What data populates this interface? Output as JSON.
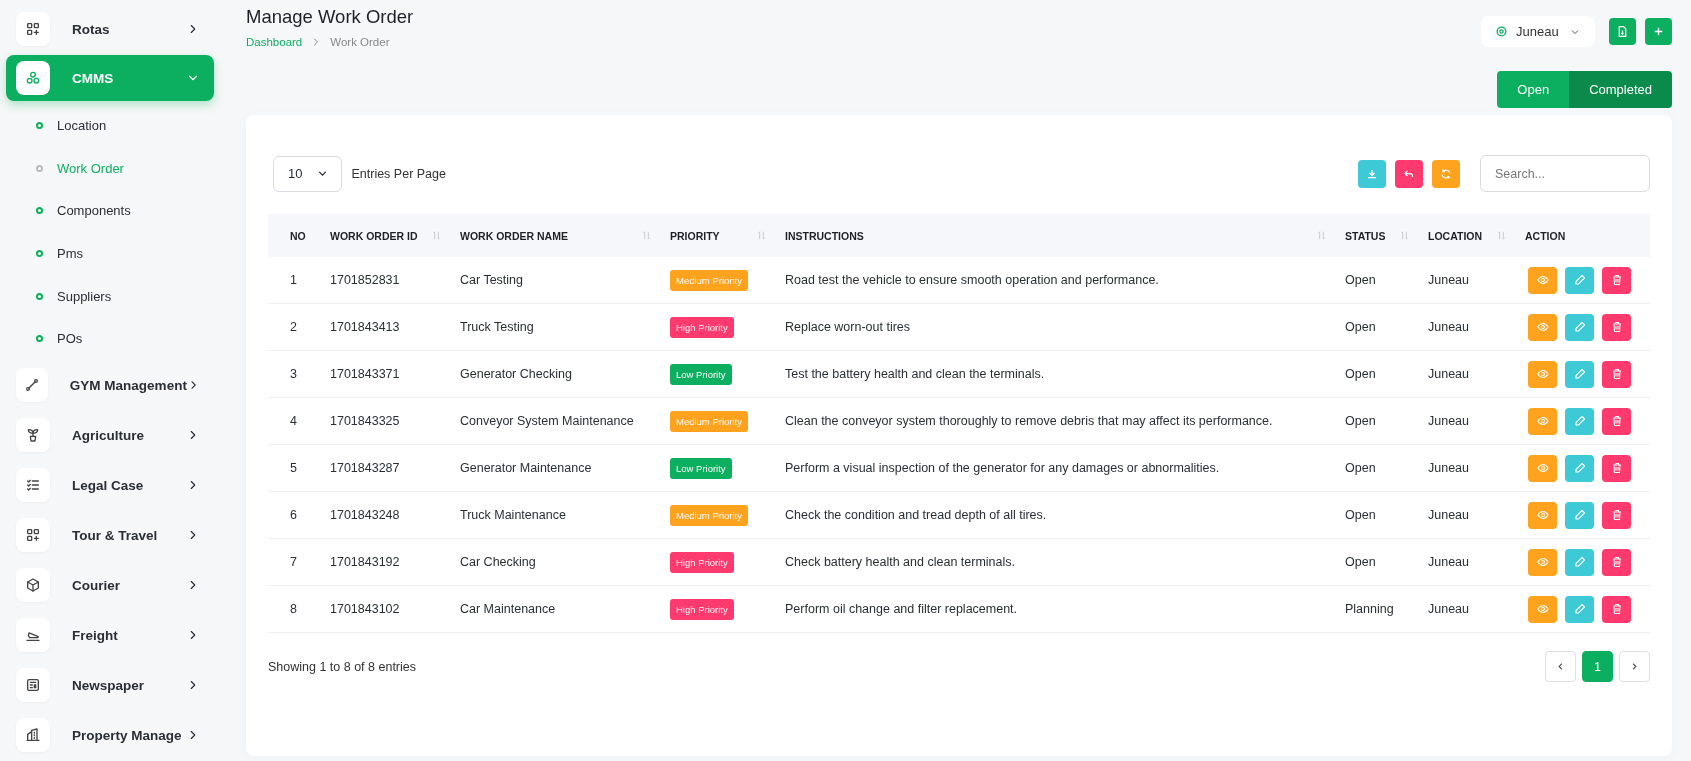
{
  "sidebar": {
    "items": [
      {
        "label": "Rotas",
        "selected": false,
        "expanded": false
      },
      {
        "label": "CMMS",
        "selected": true,
        "expanded": true,
        "children": [
          {
            "label": "Location",
            "selected": false
          },
          {
            "label": "Work Order",
            "selected": true
          },
          {
            "label": "Components",
            "selected": false
          },
          {
            "label": "Pms",
            "selected": false
          },
          {
            "label": "Suppliers",
            "selected": false
          },
          {
            "label": "POs",
            "selected": false
          }
        ]
      },
      {
        "label": "GYM Management",
        "selected": false,
        "expanded": false
      },
      {
        "label": "Agriculture",
        "selected": false,
        "expanded": false
      },
      {
        "label": "Legal Case",
        "selected": false,
        "expanded": false
      },
      {
        "label": "Tour & Travel",
        "selected": false,
        "expanded": false
      },
      {
        "label": "Courier",
        "selected": false,
        "expanded": false
      },
      {
        "label": "Freight",
        "selected": false,
        "expanded": false
      },
      {
        "label": "Newspaper",
        "selected": false,
        "expanded": false
      },
      {
        "label": "Property Manage",
        "selected": false,
        "expanded": false
      }
    ]
  },
  "header": {
    "title": "Manage Work Order",
    "breadcrumb": [
      "Dashboard",
      "Work Order"
    ],
    "location_select": {
      "value": "Juneau"
    },
    "status_toggle": [
      {
        "label": "Open",
        "selected": false
      },
      {
        "label": "Completed",
        "selected": true
      }
    ]
  },
  "table": {
    "entries_select": {
      "value": "10"
    },
    "entries_label": "Entries Per Page",
    "search": {
      "placeholder": "Search..."
    },
    "columns": [
      {
        "label": "NO",
        "sortable": false
      },
      {
        "label": "WORK ORDER ID",
        "sortable": true
      },
      {
        "label": "WORK ORDER NAME",
        "sortable": true
      },
      {
        "label": "PRIORITY",
        "sortable": true
      },
      {
        "label": "INSTRUCTIONS",
        "sortable": true
      },
      {
        "label": "STATUS",
        "sortable": true
      },
      {
        "label": "LOCATION",
        "sortable": true
      },
      {
        "label": "ACTION",
        "sortable": false
      }
    ],
    "rows": [
      {
        "no": "1",
        "id": "1701852831",
        "name": "Car Testing",
        "priority": {
          "label": "Medium Priority",
          "kind": "medium"
        },
        "instructions": "Road test the vehicle to ensure smooth operation and performance.",
        "status": "Open",
        "location": "Juneau"
      },
      {
        "no": "2",
        "id": "1701843413",
        "name": "Truck Testing",
        "priority": {
          "label": "High Priority",
          "kind": "high"
        },
        "instructions": "Replace worn-out tires",
        "status": "Open",
        "location": "Juneau"
      },
      {
        "no": "3",
        "id": "1701843371",
        "name": "Generator Checking",
        "priority": {
          "label": "Low Priority",
          "kind": "low"
        },
        "instructions": "Test the battery health and clean the terminals.",
        "status": "Open",
        "location": "Juneau"
      },
      {
        "no": "4",
        "id": "1701843325",
        "name": "Conveyor System Maintenance",
        "priority": {
          "label": "Medium Priority",
          "kind": "medium"
        },
        "instructions": "Clean the conveyor system thoroughly to remove debris that may affect its performance.",
        "status": "Open",
        "location": "Juneau"
      },
      {
        "no": "5",
        "id": "1701843287",
        "name": "Generator Maintenance",
        "priority": {
          "label": "Low Priority",
          "kind": "low"
        },
        "instructions": "Perform a visual inspection of the generator for any damages or abnormalities.",
        "status": "Open",
        "location": "Juneau"
      },
      {
        "no": "6",
        "id": "1701843248",
        "name": "Truck Maintenance",
        "priority": {
          "label": "Medium Priority",
          "kind": "medium"
        },
        "instructions": "Check the condition and tread depth of all tires.",
        "status": "Open",
        "location": "Juneau"
      },
      {
        "no": "7",
        "id": "1701843192",
        "name": "Car Checking",
        "priority": {
          "label": "High Priority",
          "kind": "high"
        },
        "instructions": "Check battery health and clean terminals.",
        "status": "Open",
        "location": "Juneau"
      },
      {
        "no": "8",
        "id": "1701843102",
        "name": "Car Maintenance",
        "priority": {
          "label": "High Priority",
          "kind": "high"
        },
        "instructions": "Perform oil change and filter replacement.",
        "status": "Planning",
        "location": "Juneau"
      }
    ],
    "info": "Showing 1 to 8 of 8 entries",
    "pagination": [
      {
        "label": "1",
        "selected": true
      }
    ]
  }
}
